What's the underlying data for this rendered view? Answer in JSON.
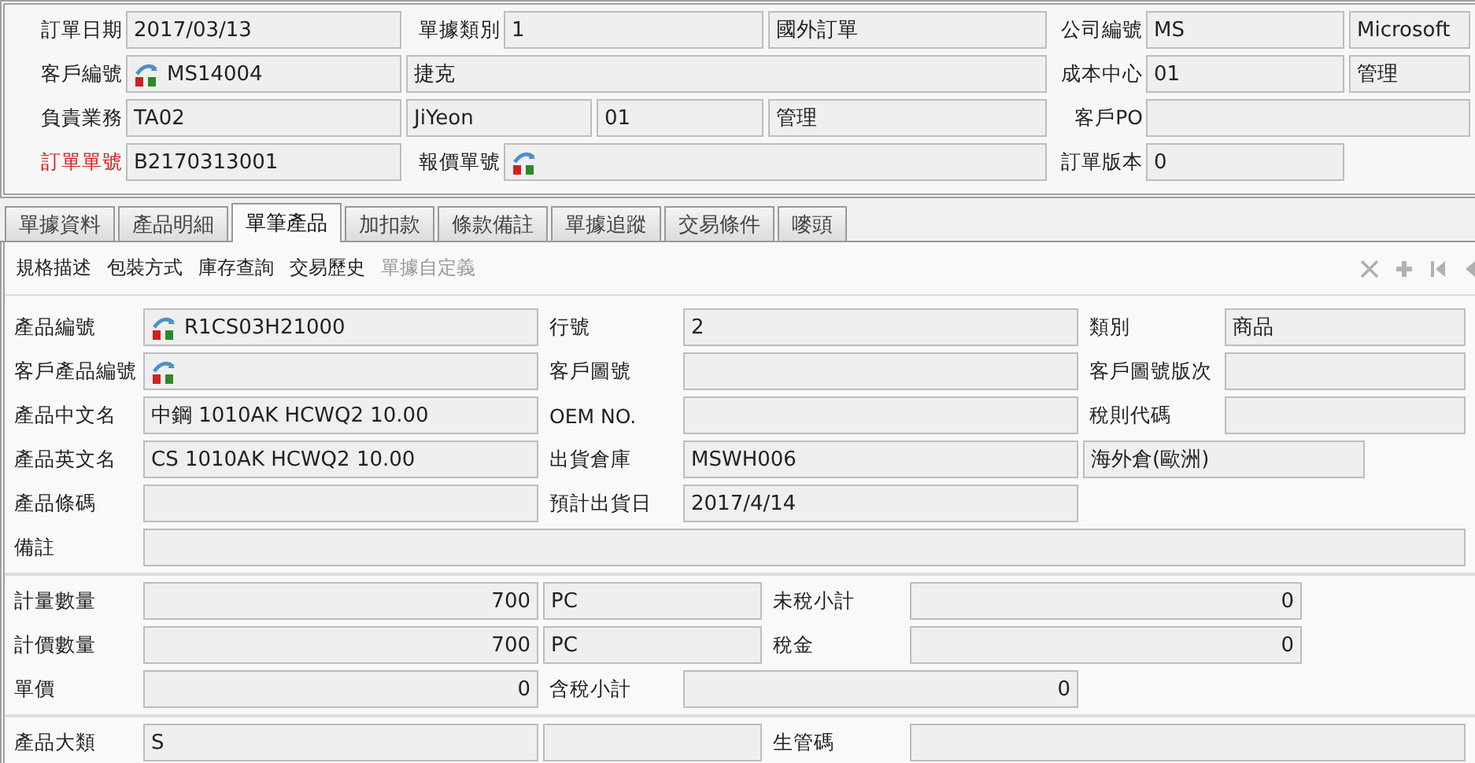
{
  "header": {
    "rows": [
      {
        "left": [
          {
            "kind": "label",
            "text": "訂單日期"
          },
          {
            "kind": "field",
            "text": "2017/03/13"
          },
          {
            "kind": "label",
            "text": "單據類別"
          },
          {
            "kind": "field",
            "text": "1"
          },
          {
            "kind": "field",
            "text": "國外訂單"
          }
        ],
        "right": [
          {
            "kind": "label",
            "text": "公司編號"
          },
          {
            "kind": "field",
            "text": "MS"
          },
          {
            "kind": "field",
            "text": "Microsoft"
          }
        ]
      },
      {
        "left": [
          {
            "kind": "label",
            "text": "客戶編號"
          },
          {
            "kind": "lookup",
            "text": "MS14004"
          },
          {
            "kind": "field",
            "text": "捷克"
          }
        ],
        "right": [
          {
            "kind": "label",
            "text": "成本中心"
          },
          {
            "kind": "field",
            "text": "01"
          },
          {
            "kind": "field",
            "text": "管理"
          }
        ]
      },
      {
        "left": [
          {
            "kind": "label",
            "text": "負責業務"
          },
          {
            "kind": "field",
            "text": "TA02"
          },
          {
            "kind": "field",
            "text": "JiYeon"
          },
          {
            "kind": "field",
            "text": "01"
          },
          {
            "kind": "field",
            "text": "管理"
          }
        ],
        "right": [
          {
            "kind": "label",
            "text": "客戶PO"
          },
          {
            "kind": "field"
          }
        ]
      },
      {
        "left": [
          {
            "kind": "required_label",
            "text": "訂單單號"
          },
          {
            "kind": "field",
            "text": "B2170313001"
          },
          {
            "kind": "label",
            "text": "報價單號"
          },
          {
            "kind": "lookup"
          }
        ],
        "right": [
          {
            "kind": "label",
            "text": "訂單版本"
          },
          {
            "kind": "field",
            "text": "0"
          }
        ]
      }
    ]
  },
  "tabs": [
    {
      "label": "單據資料",
      "selected": false
    },
    {
      "label": "產品明細",
      "selected": false
    },
    {
      "label": "單筆產品",
      "selected": true
    },
    {
      "label": "加扣款",
      "selected": false
    },
    {
      "label": "條款備註",
      "selected": false
    },
    {
      "label": "單據追蹤",
      "selected": false
    },
    {
      "label": "交易條件",
      "selected": false
    },
    {
      "label": "嘜頭",
      "selected": false
    }
  ],
  "toolbar": {
    "links": [
      {
        "label": "規格描述",
        "disabled": false
      },
      {
        "label": "包裝方式",
        "disabled": false
      },
      {
        "label": "庫存查詢",
        "disabled": false
      },
      {
        "label": "交易歷史",
        "disabled": false
      },
      {
        "label": "單據自定義",
        "disabled": true
      }
    ]
  },
  "detail": {
    "groups": [
      {
        "rows": [
          {
            "cells": [
              {
                "kind": "label",
                "text": "產品編號"
              },
              {
                "kind": "lookup",
                "text": "R1CS03H21000"
              },
              {
                "kind": "label",
                "text": "行號"
              },
              {
                "kind": "field",
                "text": "2"
              },
              {
                "kind": "label",
                "text": "類別"
              },
              {
                "kind": "field",
                "text": "商品"
              }
            ]
          },
          {
            "cells": [
              {
                "kind": "label",
                "text": "客戶產品編號"
              },
              {
                "kind": "lookup"
              },
              {
                "kind": "label",
                "text": "客戶圖號"
              },
              {
                "kind": "field"
              },
              {
                "kind": "label",
                "text": "客戶圖號版次"
              },
              {
                "kind": "field"
              }
            ]
          },
          {
            "cells": [
              {
                "kind": "label",
                "text": "產品中文名"
              },
              {
                "kind": "field",
                "text": "中鋼 1010AK HCWQ2 10.00"
              },
              {
                "kind": "label",
                "text": "OEM NO."
              },
              {
                "kind": "field"
              },
              {
                "kind": "label",
                "text": "稅則代碼"
              },
              {
                "kind": "field"
              }
            ]
          },
          {
            "cells": [
              {
                "kind": "label",
                "text": "產品英文名"
              },
              {
                "kind": "field",
                "text": "CS 1010AK HCWQ2 10.00"
              },
              {
                "kind": "label",
                "text": "出貨倉庫"
              },
              {
                "kind": "field",
                "text": "MSWH006"
              },
              {
                "kind": "field",
                "text": "海外倉(歐洲)"
              }
            ]
          },
          {
            "cells": [
              {
                "kind": "label",
                "text": "產品條碼"
              },
              {
                "kind": "field"
              },
              {
                "kind": "label",
                "text": "預計出貨日"
              },
              {
                "kind": "field",
                "text": "2017/4/14"
              }
            ]
          },
          {
            "cells": [
              {
                "kind": "label",
                "text": "備註"
              },
              {
                "kind": "field"
              }
            ]
          }
        ]
      },
      {
        "rows": [
          {
            "cells": [
              {
                "kind": "label",
                "text": "計量數量"
              },
              {
                "kind": "number",
                "text": "700"
              },
              {
                "kind": "field",
                "text": "PC"
              },
              {
                "kind": "label",
                "text": "未稅小計"
              },
              {
                "kind": "number",
                "text": "0"
              }
            ]
          },
          {
            "cells": [
              {
                "kind": "label",
                "text": "計價數量"
              },
              {
                "kind": "number",
                "text": "700"
              },
              {
                "kind": "field",
                "text": "PC"
              },
              {
                "kind": "label",
                "text": "稅金"
              },
              {
                "kind": "number",
                "text": "0"
              }
            ]
          },
          {
            "cells": [
              {
                "kind": "label",
                "text": "單價"
              },
              {
                "kind": "number",
                "text": "0"
              },
              {
                "kind": "label",
                "text": "含稅小計"
              },
              {
                "kind": "number",
                "text": "0"
              }
            ]
          }
        ]
      },
      {
        "rows": [
          {
            "cells": [
              {
                "kind": "label",
                "text": "產品大類"
              },
              {
                "kind": "field",
                "text": "S"
              },
              {
                "kind": "field"
              },
              {
                "kind": "label",
                "text": "生管碼"
              },
              {
                "kind": "field"
              }
            ]
          }
        ]
      }
    ]
  }
}
